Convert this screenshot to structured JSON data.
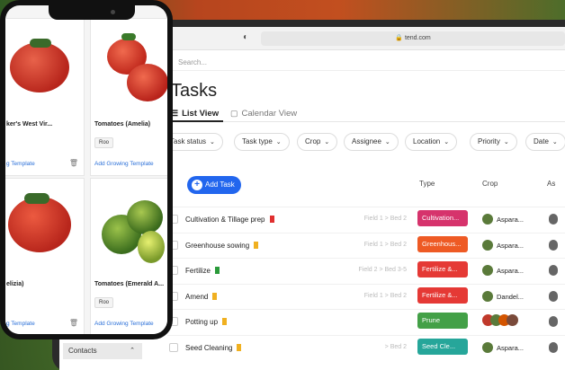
{
  "browser": {
    "url": "tend.com"
  },
  "app": {
    "search_placeholder": "Search...",
    "title": "Tasks",
    "tabs": [
      {
        "label": "List View"
      },
      {
        "label": "Calendar View"
      }
    ],
    "filters": [
      {
        "label": "Task status"
      },
      {
        "label": "Task type"
      },
      {
        "label": "Crop"
      },
      {
        "label": "Assignee"
      },
      {
        "label": "Location"
      },
      {
        "label": "Priority"
      },
      {
        "label": "Date"
      }
    ],
    "add_task_label": "Add Task",
    "columns": {
      "type": "Type",
      "crop": "Crop",
      "assignee": "As"
    },
    "rows": [
      {
        "name": "Cultivation & Tillage prep",
        "flag": "#e03030",
        "location": "Field 1 > Bed 2",
        "type": "Cultivation...",
        "type_color": "#d6336c",
        "crop": "Aspara..."
      },
      {
        "name": "Greenhouse sowing",
        "flag": "#f0b020",
        "location": "Field 1 > Bed 2",
        "type": "Greenhous...",
        "type_color": "#ee5a24",
        "crop": "Aspara..."
      },
      {
        "name": "Fertilize",
        "flag": "#2a9a3a",
        "location": "Field 2 > Bed 3-5",
        "type": "Fertilize &...",
        "type_color": "#e53935",
        "crop": "Aspara..."
      },
      {
        "name": "Amend",
        "flag": "#f0b020",
        "location": "Field 1 > Bed 2",
        "type": "Fertilize &...",
        "type_color": "#e53935",
        "crop": "Dandel..."
      },
      {
        "name": "Potting up",
        "flag": "#f0b020",
        "location": "",
        "type": "Prune",
        "type_color": "#43a047",
        "crop": ""
      },
      {
        "name": "Seed Cleaning",
        "flag": "#f0b020",
        "location": "> Bed 2",
        "type": "Seed Cle...",
        "type_color": "#26a69a",
        "crop": "Aspara..."
      }
    ],
    "contacts_label": "Contacts"
  },
  "phone": {
    "cards": [
      {
        "name": "ker's West Vir...",
        "tag": "",
        "link": "g Template"
      },
      {
        "name": "Tomatoes (Amelia)",
        "tag": "Roo",
        "link": "Add Growing Template"
      },
      {
        "name": "elizia)",
        "tag": "",
        "link": "g Template"
      },
      {
        "name": "Tomatoes (Emerald A...",
        "tag": "Roo",
        "link": "Add Growing Template"
      }
    ]
  },
  "colors": {
    "accent": "#2266ee",
    "link": "#2a6fd8"
  }
}
